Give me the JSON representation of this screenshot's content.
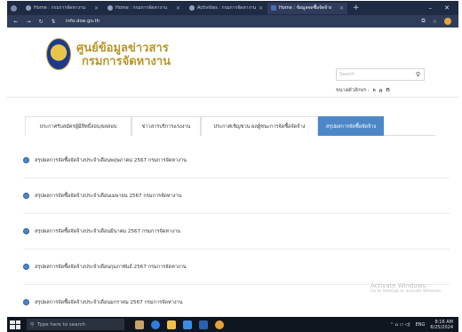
{
  "browser": {
    "tabs": [
      {
        "label": "Home : กรมการจัดหางาน",
        "active": false
      },
      {
        "label": "Home : กรมการจัดหางาน",
        "active": false
      },
      {
        "label": "Activities : กรมการจัดหางาน",
        "active": false
      },
      {
        "label": "Home : ข้อมูลจดซื้อจัดจ้าง",
        "active": true
      }
    ],
    "new_tab": "+",
    "url": "info.doe.go.th",
    "window_controls": {
      "minimize": "–",
      "close": "✕"
    }
  },
  "header": {
    "title_line1": "ศูนย์ข้อมูลข่าวสาร",
    "title_line2": "กรมการจัดหางาน",
    "search_placeholder": "Search",
    "search_icon": "search-icon",
    "fontsize_label": "ขนาดตัวอักษร :",
    "fontsize_options": [
      "ก",
      "ก",
      "ก"
    ]
  },
  "category_tabs": [
    {
      "label": "ประกาศรับสมัครผู้มีสิทธิ์สอบ/ผลสอบ",
      "active": false
    },
    {
      "label": "ข่าวสารบริการแรงงาน",
      "active": false
    },
    {
      "label": "ประกาศเชิญชวน ผลผู้ชนะการจัดซื้อจัดจ้าง",
      "active": false
    },
    {
      "label": "สรุปผลการจัดซื้อจัดจ้าง",
      "active": true
    }
  ],
  "list": [
    "สรุปผลการจัดซื้อจัดจ้างประจำเดือนพฤษภาคม 2567 กรมการจัดหางาน",
    "สรุปผลการจัดซื้อจัดจ้างประจำเดือนเมษายน 2567 กรมการจัดหางาน",
    "สรุปผลการจัดซื้อจัดจ้างประจำเดือนมีนาคม 2567 กรมการจัดหางาน",
    "สรุปผลการจัดซื้อจัดจ้างประจำเดือนกุมภาพันธ์ 2567 กรมการจัดหางาน",
    "สรุปผลการจัดซื้อจัดจ้างประจำเดือนมกราคม 2567 กรมการจัดหางาน"
  ],
  "watermark": {
    "line1": "Activate Windows",
    "line2": "Go to Settings to activate Windows."
  },
  "taskbar": {
    "search_placeholder": "Type here to search",
    "tray_lang": "ENG",
    "time": "8:16 AM",
    "date": "6/25/2024"
  },
  "colors": {
    "accent": "#4e87c8",
    "brand_gold": "#b8962a"
  }
}
